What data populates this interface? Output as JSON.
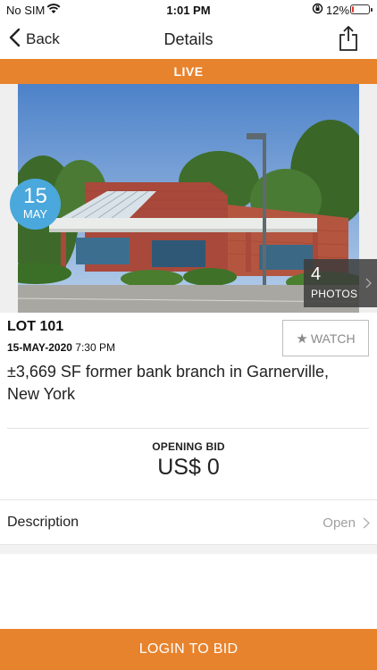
{
  "status_bar": {
    "carrier": "No SIM",
    "time": "1:01 PM",
    "battery_percent": "12%",
    "battery_level": 0.12,
    "battery_color": "#e53b2f",
    "icons": [
      "wifi-icon",
      "orientation-lock-icon",
      "battery-icon"
    ]
  },
  "nav": {
    "back_label": "Back",
    "title": "Details",
    "icons": [
      "chevron-left-icon",
      "share-icon"
    ]
  },
  "banner": {
    "label": "LIVE",
    "color": "#e8832d"
  },
  "hero": {
    "date_day": "15",
    "date_month": "MAY",
    "badge_color": "#4aa8dc",
    "photos_count": "4",
    "photos_label": "PHOTOS"
  },
  "lot": {
    "number": "LOT 101",
    "date": "15-MAY-2020",
    "time": "7:30 PM",
    "watch_label": "WATCH",
    "title": "±3,669 SF former bank branch in Garnerville, New York"
  },
  "bid": {
    "label": "OPENING BID",
    "value": "US$ 0"
  },
  "description": {
    "label": "Description",
    "action": "Open"
  },
  "footer": {
    "login_label": "LOGIN TO BID",
    "color": "#e8832d"
  }
}
